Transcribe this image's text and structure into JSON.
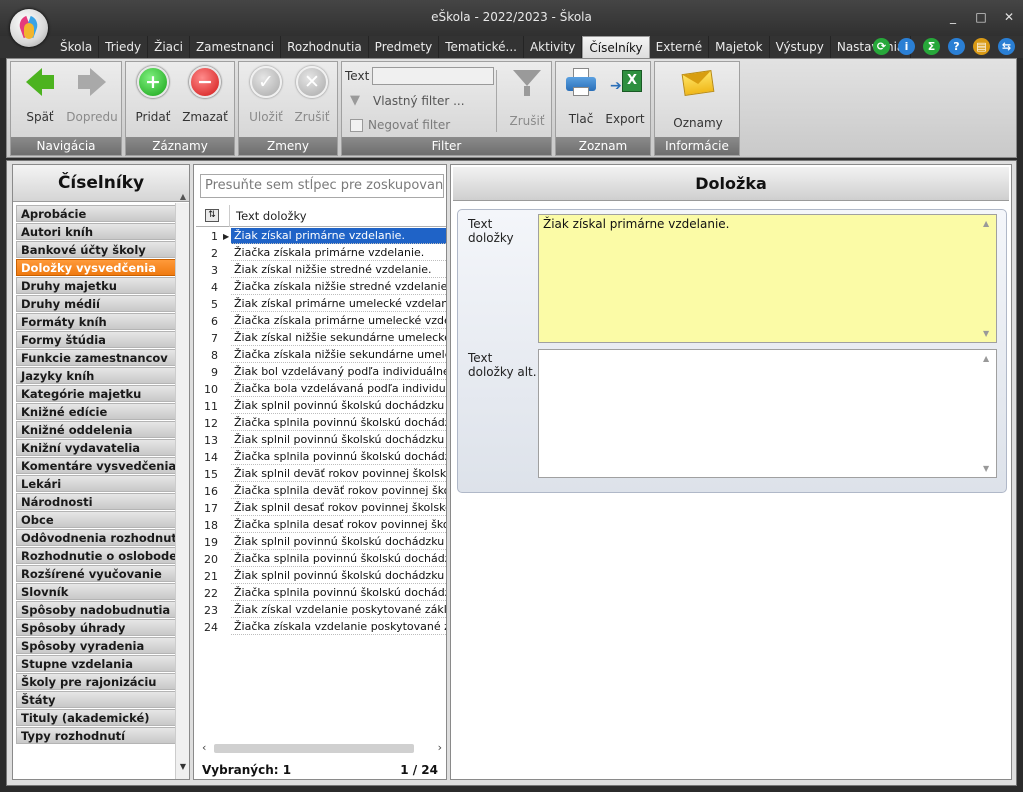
{
  "window": {
    "title": "eŠkola - 2022/2023 - Škola",
    "controls": [
      "_",
      "□",
      "✕"
    ]
  },
  "menu": {
    "tabs": [
      "Škola",
      "Triedy",
      "Žiaci",
      "Zamestnanci",
      "Rozhodnutia",
      "Predmety",
      "Tematické...",
      "Aktivity",
      "Číselníky",
      "Externé",
      "Majetok",
      "Výstupy",
      "Nastavenia"
    ],
    "active_tab": "Číselníky",
    "icons": [
      {
        "name": "refresh-icon",
        "glyph": "⟳",
        "color": "#27a83a"
      },
      {
        "name": "info-icon",
        "glyph": "i",
        "color": "#2a7fd4"
      },
      {
        "name": "sum-icon",
        "glyph": "Σ",
        "color": "#27a83a"
      },
      {
        "name": "help-icon",
        "glyph": "?",
        "color": "#2a7fd4"
      },
      {
        "name": "tools-icon",
        "glyph": "▤",
        "color": "#d99a16"
      },
      {
        "name": "logout-icon",
        "glyph": "⇆",
        "color": "#2a7fd4"
      }
    ]
  },
  "ribbon": {
    "groups": {
      "navigation": "Navigácia",
      "records": "Záznamy",
      "changes": "Zmeny",
      "filter": "Filter",
      "list": "Zoznam",
      "info": "Informácie"
    },
    "buttons": {
      "back": "Späť",
      "forward": "Dopredu",
      "add": "Pridať",
      "delete": "Zmazať",
      "save": "Uložiť",
      "cancel": "Zrušiť",
      "filter_cancel": "Zrušiť",
      "print": "Tlač",
      "export": "Export",
      "announcements": "Oznamy"
    },
    "filter": {
      "text_label": "Text",
      "text_value": "",
      "custom_filter": "Vlastný filter ...",
      "negate_filter": "Negovať filter"
    }
  },
  "left_panel": {
    "title": "Číselníky",
    "items": [
      "Aprobácie",
      "Autori kníh",
      "Bankové účty školy",
      "Doložky vysvedčenia",
      "Druhy majetku",
      "Druhy médií",
      "Formáty kníh",
      "Formy štúdia",
      "Funkcie zamestnancov",
      "Jazyky kníh",
      "Kategórie majetku",
      "Knižné edície",
      "Knižné oddelenia",
      "Knižní vydavatelia",
      "Komentáre vysvedčenia",
      "Lekári",
      "Národnosti",
      "Obce",
      "Odôvodnenia rozhodnutí",
      "Rozhodnutie o oslobodení",
      "Rozšírené vyučovanie",
      "Slovník",
      "Spôsoby nadobudnutia",
      "Spôsoby úhrady",
      "Spôsoby vyradenia",
      "Stupne vzdelania",
      "Školy pre rajonizáciu",
      "Štáty",
      "Tituly (akademické)",
      "Typy rozhodnutí"
    ],
    "active_index": 3
  },
  "grid": {
    "group_placeholder": "Presuňte sem stĺpec pre zoskupovanie h",
    "column_title": "Text doložky",
    "rows": [
      "Žiak získal primárne vzdelanie.",
      "Žiačka získala primárne vzdelanie.",
      "Žiak získal nižšie stredné vzdelanie.",
      "Žiačka získala nižšie stredné vzdelanie.",
      "Žiak získal primárne umelecké vzdelanie.",
      "Žiačka získala primárne umelecké vzdelanie.",
      "Žiak získal nižšie sekundárne umelecké vzde",
      "Žiačka získala nižšie sekundárne umelecké",
      "Žiak bol vzdelávaný podľa individuálneho vz.",
      "Žiačka bola vzdelávaná podľa individuálneh.",
      "Žiak splnil povinnú školskú dochádzku a získ",
      "Žiačka splnila povinnú školskú dochádzku a",
      "Žiak splnil povinnú školskú dochádzku a nez",
      "Žiačka splnila povinnú školskú dochádzku a",
      "Žiak splnil deväť rokov povinnej školskej doc",
      "Žiačka splnila deväť rokov povinnej školskej",
      "Žiak splnil desať rokov povinnej školskej doc",
      "Žiačka splnila desať rokov povinnej školskej",
      "Žiak splnil povinnú školskú dochádzku a získ",
      "Žiačka splnila povinnú školskú dochádzku a",
      "Žiak splnil povinnú školskú dochádzku a nez",
      "Žiačka splnila povinnú školskú dochádzku a",
      "Žiak získal vzdelanie poskytované základno.",
      "Žiačka získala vzdelanie poskytované zákla."
    ],
    "selected_index": 0,
    "footer_label": "Vybraných: 1",
    "footer_count": "1 / 24"
  },
  "detail": {
    "title": "Doložka",
    "field1_label": "Text doložky",
    "field1_value": "Žiak získal primárne vzdelanie.",
    "field2_label": "Text doložky alt.",
    "field2_value": ""
  },
  "colors": {
    "accent_orange": "#f07a10",
    "selection_blue": "#1f63c7",
    "memo_yellow": "#fbfba6"
  }
}
